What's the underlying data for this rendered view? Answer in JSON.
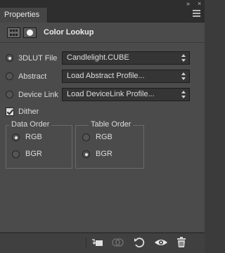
{
  "window": {
    "collapse_icon": "double-chevron-right-icon",
    "close_icon": "close-icon"
  },
  "tab": {
    "label": "Properties",
    "menu_icon": "panel-menu-icon"
  },
  "header": {
    "adjustment_icon": "adjustment-grid-icon",
    "mask_icon": "mask-icon",
    "title": "Color Lookup"
  },
  "options": [
    {
      "label": "3DLUT File",
      "selected": true,
      "value": "Candlelight.CUBE"
    },
    {
      "label": "Abstract",
      "selected": false,
      "value": "Load Abstract Profile..."
    },
    {
      "label": "Device Link",
      "selected": false,
      "value": "Load DeviceLink Profile..."
    }
  ],
  "dither": {
    "label": "Dither",
    "checked": true
  },
  "data_order": {
    "legend": "Data Order",
    "options": [
      {
        "label": "RGB",
        "selected": true
      },
      {
        "label": "BGR",
        "selected": false
      }
    ]
  },
  "table_order": {
    "legend": "Table Order",
    "options": [
      {
        "label": "RGB",
        "selected": false
      },
      {
        "label": "BGR",
        "selected": true
      }
    ]
  },
  "bottom_toolbar": {
    "icons": [
      "clip-to-layer-icon",
      "view-previous-state-icon",
      "reset-icon",
      "visibility-eye-icon",
      "trash-icon"
    ]
  }
}
